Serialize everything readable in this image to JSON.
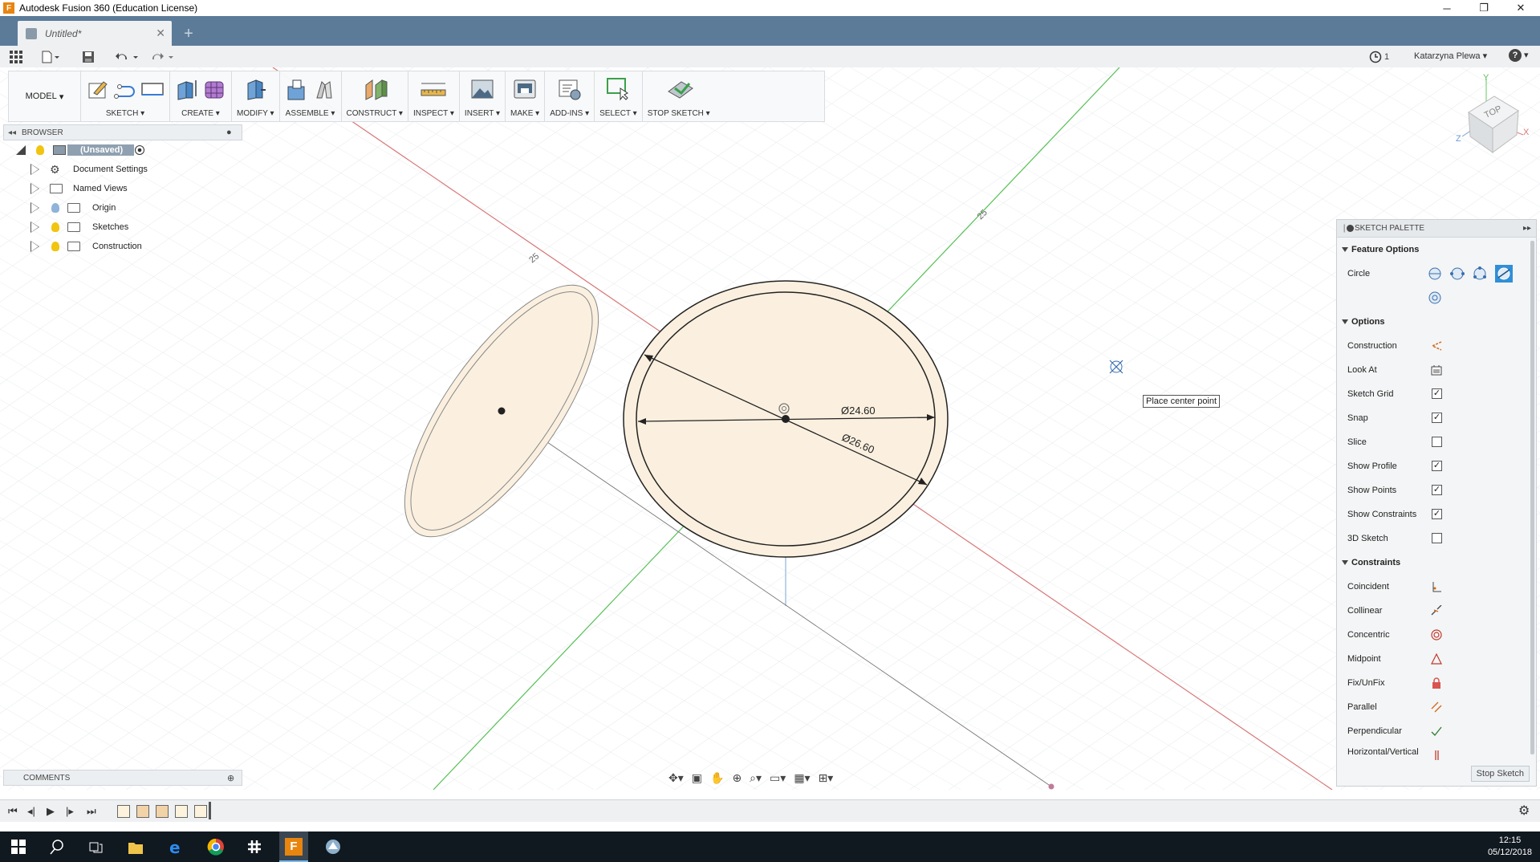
{
  "window": {
    "title": "Autodesk Fusion 360 (Education License)",
    "icon_letter": "F",
    "min": "─",
    "max": "❐",
    "close": "✕"
  },
  "tab": {
    "label": "Untitled*",
    "close": "✕",
    "new": "+"
  },
  "quick_access": {
    "jobs_count": "1",
    "user": "Katarzyna Plewa",
    "help": "?"
  },
  "toolbar": {
    "model_label": "MODEL",
    "groups": [
      "SKETCH",
      "CREATE",
      "MODIFY",
      "ASSEMBLE",
      "CONSTRUCT",
      "INSPECT",
      "INSERT",
      "MAKE",
      "ADD-INS",
      "SELECT",
      "STOP SKETCH"
    ]
  },
  "browser": {
    "title": "BROWSER",
    "root": "(Unsaved)",
    "items": [
      "Document Settings",
      "Named Views",
      "Origin",
      "Sketches",
      "Construction"
    ]
  },
  "comments": {
    "title": "COMMENTS"
  },
  "palette": {
    "title": "SKETCH PALETTE",
    "feature_options": "Feature Options",
    "circle_label": "Circle",
    "options_title": "Options",
    "options": [
      {
        "label": "Construction",
        "type": "icon",
        "icon": "construction-icon"
      },
      {
        "label": "Look At",
        "type": "icon",
        "icon": "look-at-icon"
      },
      {
        "label": "Sketch Grid",
        "type": "check",
        "checked": "✓"
      },
      {
        "label": "Snap",
        "type": "check",
        "checked": "✓"
      },
      {
        "label": "Slice",
        "type": "check",
        "checked": ""
      },
      {
        "label": "Show Profile",
        "type": "check",
        "checked": "✓"
      },
      {
        "label": "Show Points",
        "type": "check",
        "checked": "✓"
      },
      {
        "label": "Show Constraints",
        "type": "check",
        "checked": "✓"
      },
      {
        "label": "3D Sketch",
        "type": "check",
        "checked": ""
      }
    ],
    "constraints_title": "Constraints",
    "constraints": [
      {
        "label": "Coincident",
        "icon": "coincident-icon"
      },
      {
        "label": "Collinear",
        "icon": "collinear-icon"
      },
      {
        "label": "Concentric",
        "icon": "concentric-icon"
      },
      {
        "label": "Midpoint",
        "icon": "midpoint-icon"
      },
      {
        "label": "Fix/UnFix",
        "icon": "fix-icon"
      },
      {
        "label": "Parallel",
        "icon": "parallel-icon"
      },
      {
        "label": "Perpendicular",
        "icon": "perpendicular-icon"
      },
      {
        "label": "Horizontal/Vertical",
        "icon": "horizontal-vertical-icon"
      }
    ],
    "stop_sketch": "Stop Sketch"
  },
  "canvas": {
    "dim_inner": "Ø24.60",
    "dim_outer": "Ø26.60",
    "axis_tick_1": "25",
    "axis_tick_2": "25",
    "tooltip": "Place center point"
  },
  "viewcube": {
    "face": "TOP",
    "x": "X",
    "y": "Y",
    "z": "Z"
  },
  "taskbar": {
    "time": "12:15",
    "date": "05/12/2018"
  },
  "colors": {
    "tab_bar": "#5c7b98",
    "sketch_fill": "#fbf0df",
    "x_axis": "#d97777",
    "y_axis": "#55c055",
    "taskbar": "#101820"
  }
}
